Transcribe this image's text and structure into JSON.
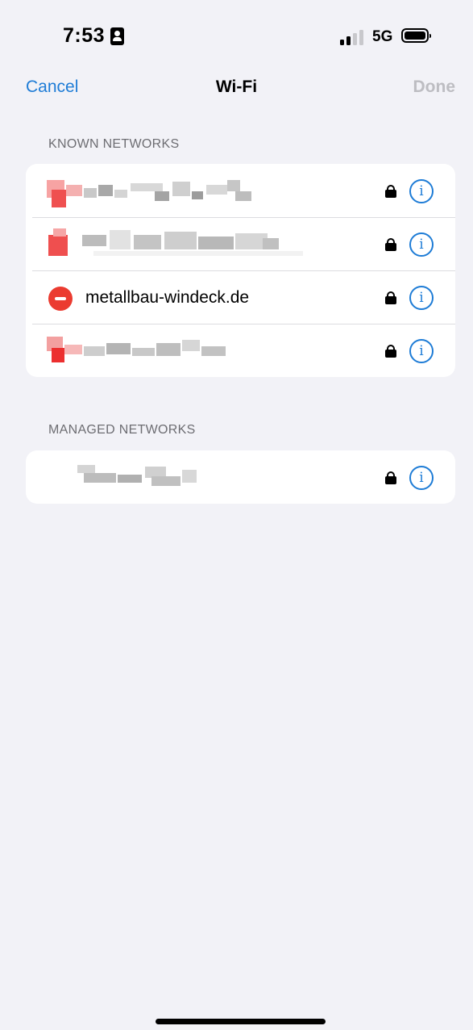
{
  "status_bar": {
    "time": "7:53",
    "network_type": "5G"
  },
  "nav": {
    "cancel_label": "Cancel",
    "title": "Wi-Fi",
    "done_label": "Done"
  },
  "known_networks": {
    "header": "KNOWN NETWORKS",
    "highlighted_network": "metallbau-windeck.de"
  },
  "managed_networks": {
    "header": "MANAGED NETWORKS"
  },
  "icons": {
    "delete": "minus-circle-icon",
    "lock": "lock-icon",
    "info": "info-circle-icon",
    "info_glyph": "i"
  },
  "colors": {
    "accent": "#1e7cd6",
    "delete_red": "#eb3b30",
    "background": "#f2f2f7",
    "done_disabled": "#bdbdc2"
  }
}
